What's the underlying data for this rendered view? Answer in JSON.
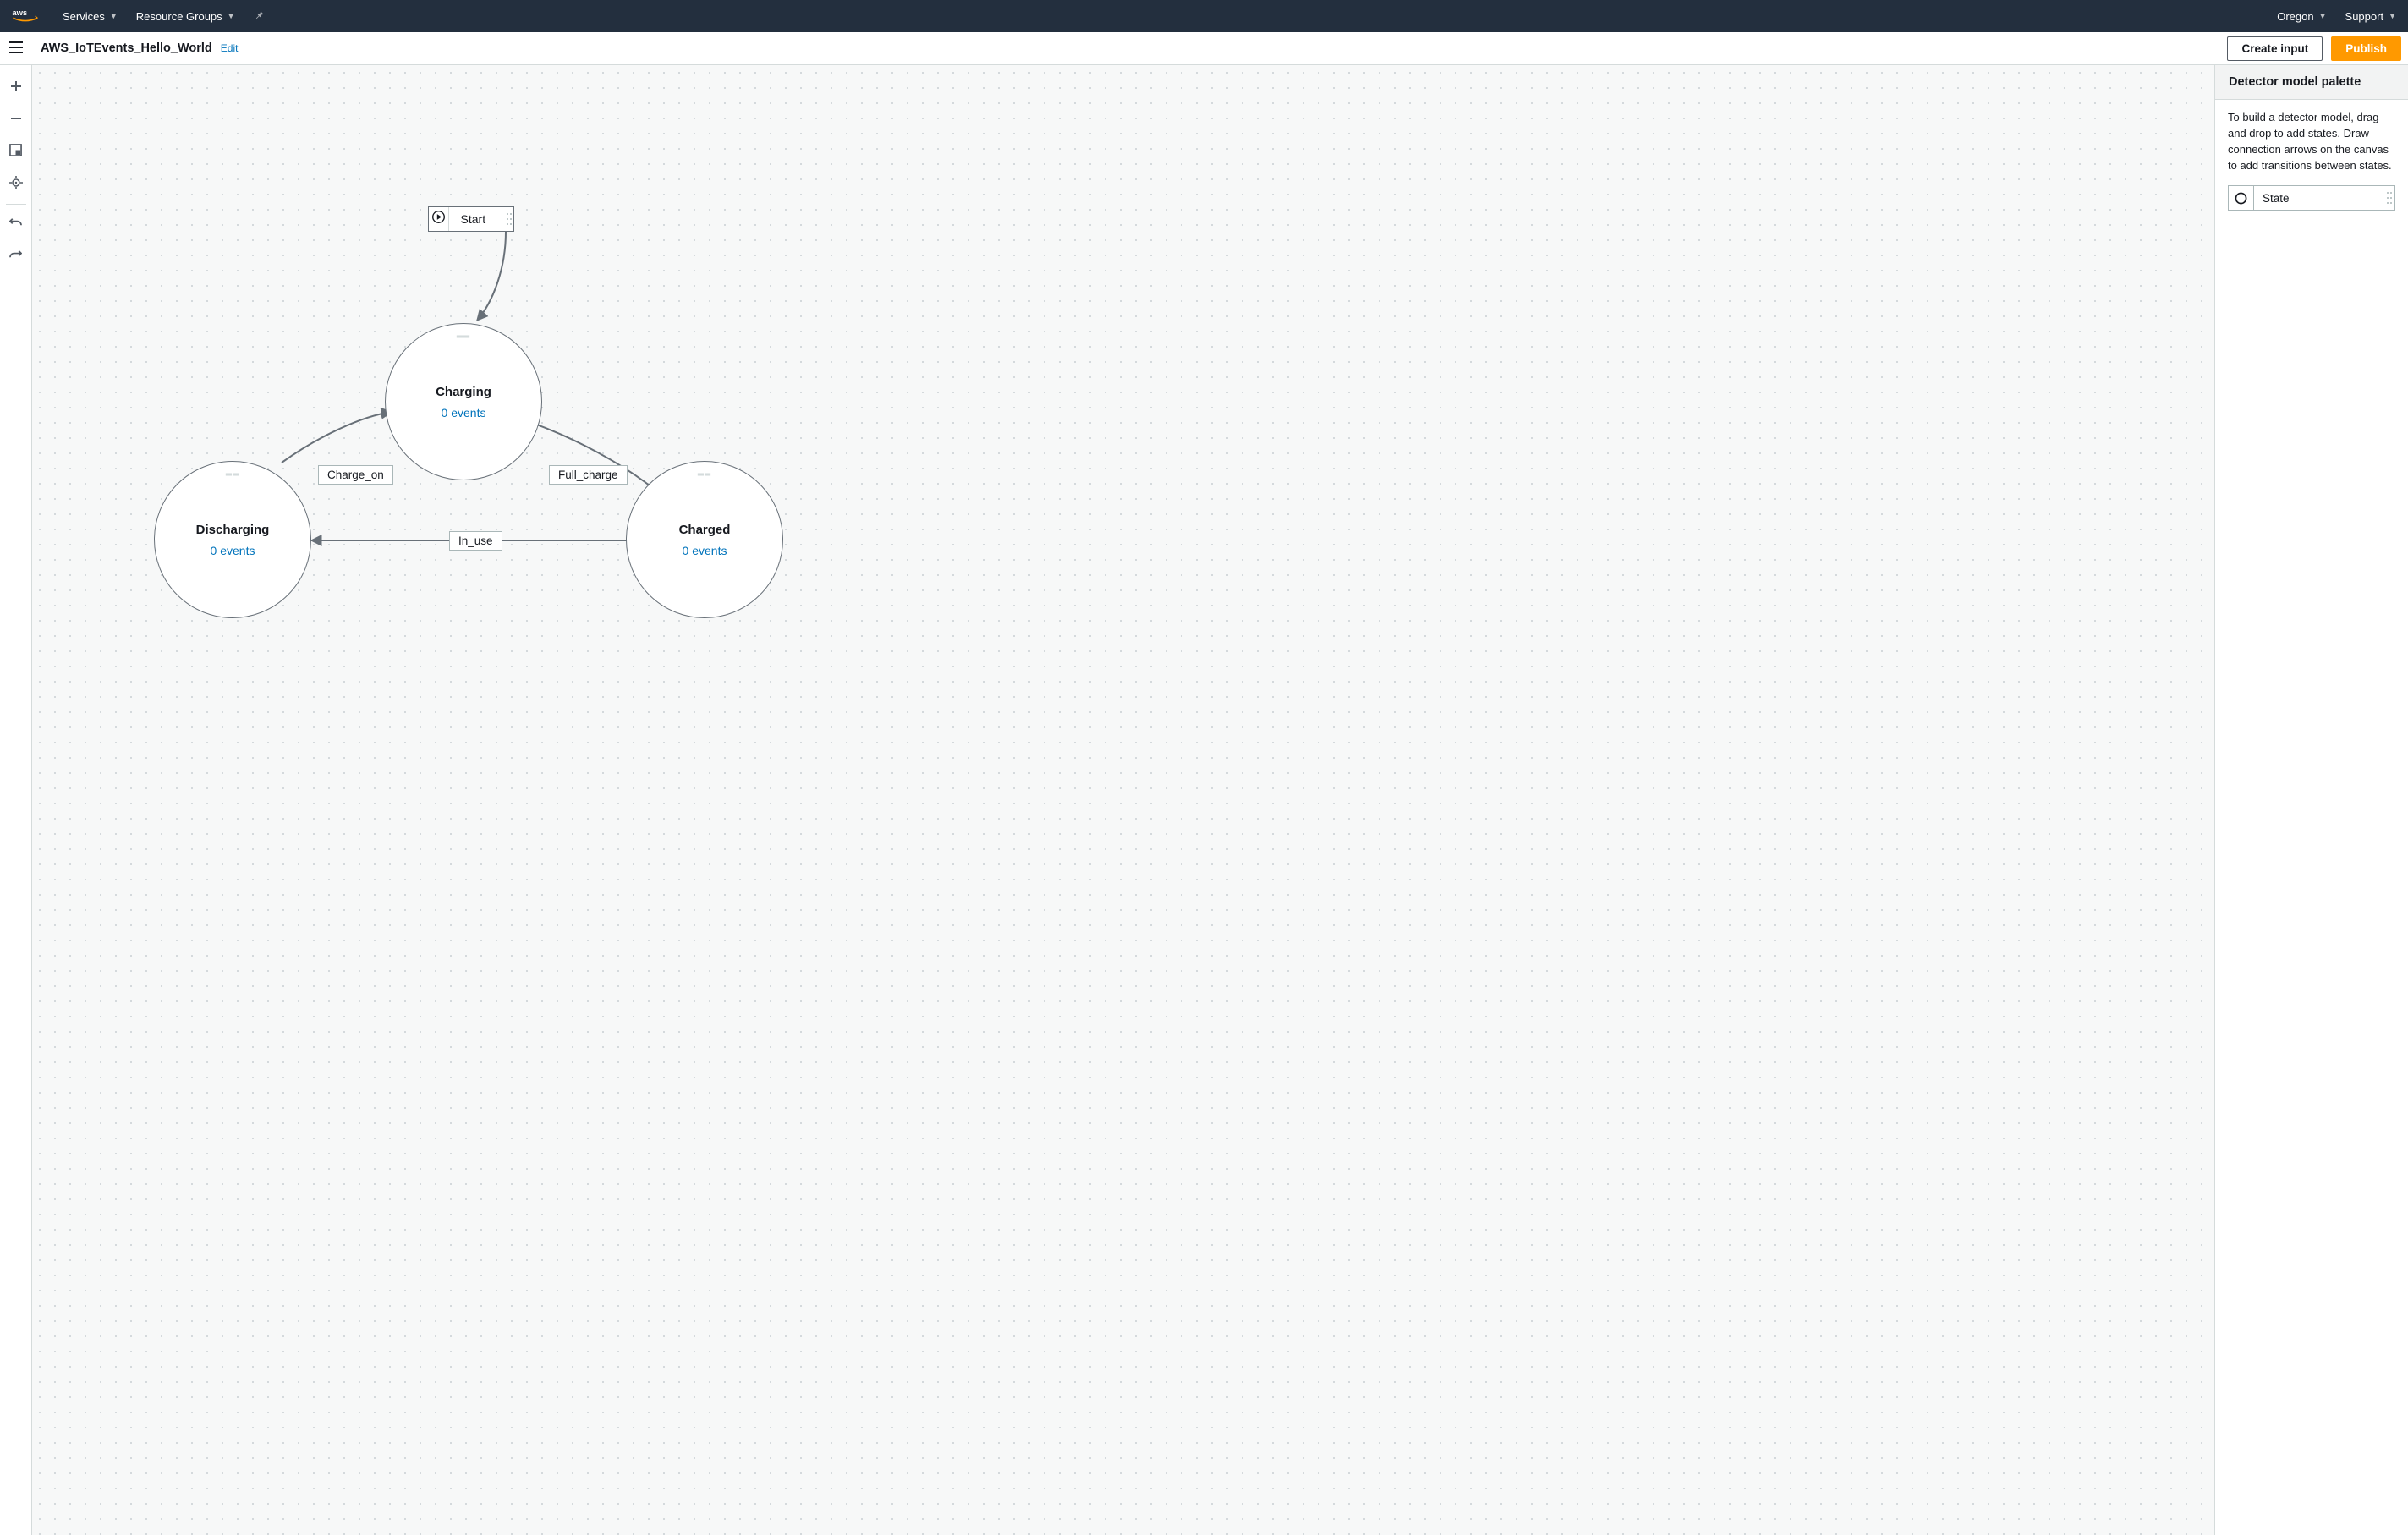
{
  "nav": {
    "brand": "aws",
    "services": "Services",
    "resource_groups": "Resource Groups",
    "region": "Oregon",
    "support": "Support"
  },
  "secbar": {
    "model_name": "AWS_IoTEvents_Hello_World",
    "edit": "Edit",
    "create_input": "Create input",
    "publish": "Publish"
  },
  "palette": {
    "heading": "Detector model palette",
    "help": "To build a detector model, drag and drop to add states. Draw connection arrows on the canvas to add transitions between states.",
    "state_item": "State"
  },
  "canvas": {
    "start": "Start",
    "states": {
      "charging": {
        "name": "Charging",
        "events": "0 events"
      },
      "discharging": {
        "name": "Discharging",
        "events": "0 events"
      },
      "charged": {
        "name": "Charged",
        "events": "0 events"
      }
    },
    "transitions": {
      "charge_on": "Charge_on",
      "full_charge": "Full_charge",
      "in_use": "In_use"
    }
  }
}
